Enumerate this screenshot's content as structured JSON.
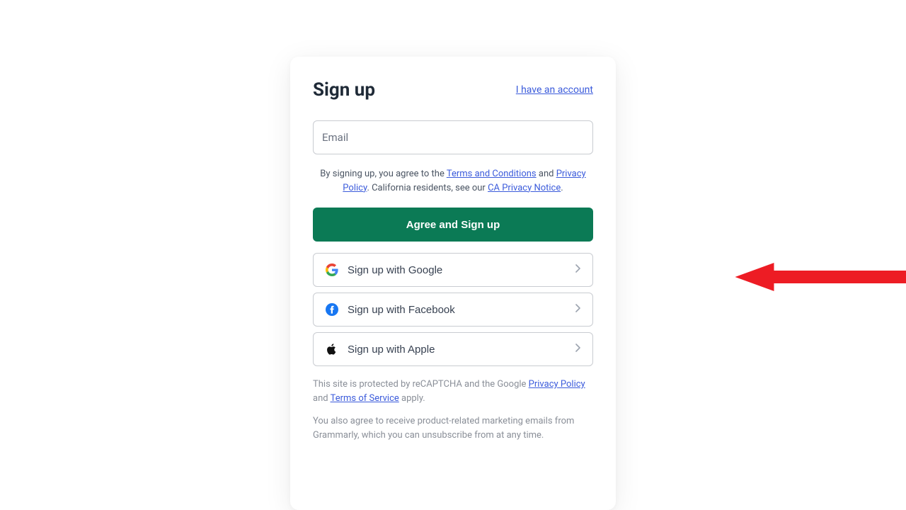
{
  "header": {
    "title": "Sign up",
    "existing_link": "I have an account"
  },
  "email": {
    "placeholder": "Email",
    "value": ""
  },
  "legal": {
    "prefix": "By signing up, you agree to the ",
    "terms": "Terms and Conditions",
    "and": " and ",
    "privacy": "Privacy Policy",
    "ca_prefix": ". California residents, see our ",
    "ca_notice": "CA Privacy Notice",
    "suffix": "."
  },
  "primary_button": "Agree and Sign up",
  "social": {
    "google": "Sign up with Google",
    "facebook": "Sign up with Facebook",
    "apple": "Sign up with Apple"
  },
  "footer": {
    "recaptcha_prefix": "This site is protected by reCAPTCHA and the Google ",
    "privacy": "Privacy Policy",
    "and": " and ",
    "tos": "Terms of Service",
    "recaptcha_suffix": " apply.",
    "marketing": "You also agree to receive product-related marketing emails from Grammarly, which you can unsubscribe from at any time."
  }
}
